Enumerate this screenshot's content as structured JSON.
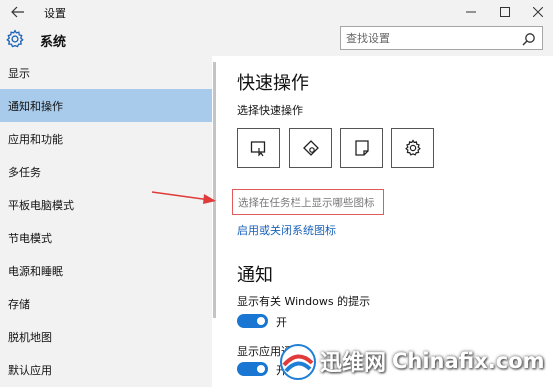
{
  "window": {
    "title": "设置",
    "back_icon": "back-arrow-icon",
    "minimize_icon": "minimize-icon",
    "maximize_icon": "maximize-icon",
    "close_icon": "close-icon"
  },
  "header": {
    "icon": "gear-icon",
    "title": "系统"
  },
  "search": {
    "placeholder": "查找设置",
    "icon": "search-icon"
  },
  "sidebar": {
    "items": [
      {
        "label": "显示",
        "active": false
      },
      {
        "label": "通知和操作",
        "active": true
      },
      {
        "label": "应用和功能",
        "active": false
      },
      {
        "label": "多任务",
        "active": false
      },
      {
        "label": "平板电脑模式",
        "active": false
      },
      {
        "label": "节电模式",
        "active": false
      },
      {
        "label": "电源和睡眠",
        "active": false
      },
      {
        "label": "存储",
        "active": false
      },
      {
        "label": "脱机地图",
        "active": false
      },
      {
        "label": "默认应用",
        "active": false
      }
    ],
    "active_color": "#a9cbeb"
  },
  "content": {
    "quick_actions_title": "快速操作",
    "choose_quick_actions": "选择快速操作",
    "tiles": [
      {
        "icon": "tablet-mode-icon"
      },
      {
        "icon": "location-icon"
      },
      {
        "icon": "note-icon"
      },
      {
        "icon": "settings-gear-icon"
      }
    ],
    "taskbar_icons_link": "选择在任务栏上显示哪些图标",
    "system_icons_link": "启用或关闭系统图标",
    "notifications_title": "通知",
    "notif1_label": "显示有关 Windows 的提示",
    "notif1_toggle": "开",
    "notif2_label": "显示应用通知",
    "notif2_toggle": "开"
  },
  "watermark": {
    "brand_cn": "迅维网",
    "brand_en": "Chinafix.com"
  },
  "colors": {
    "link": "#1a62b8",
    "toggle_on": "#1976d2",
    "highlight_box": "#e15b5b",
    "annotation_arrow": "#e03a3a"
  }
}
